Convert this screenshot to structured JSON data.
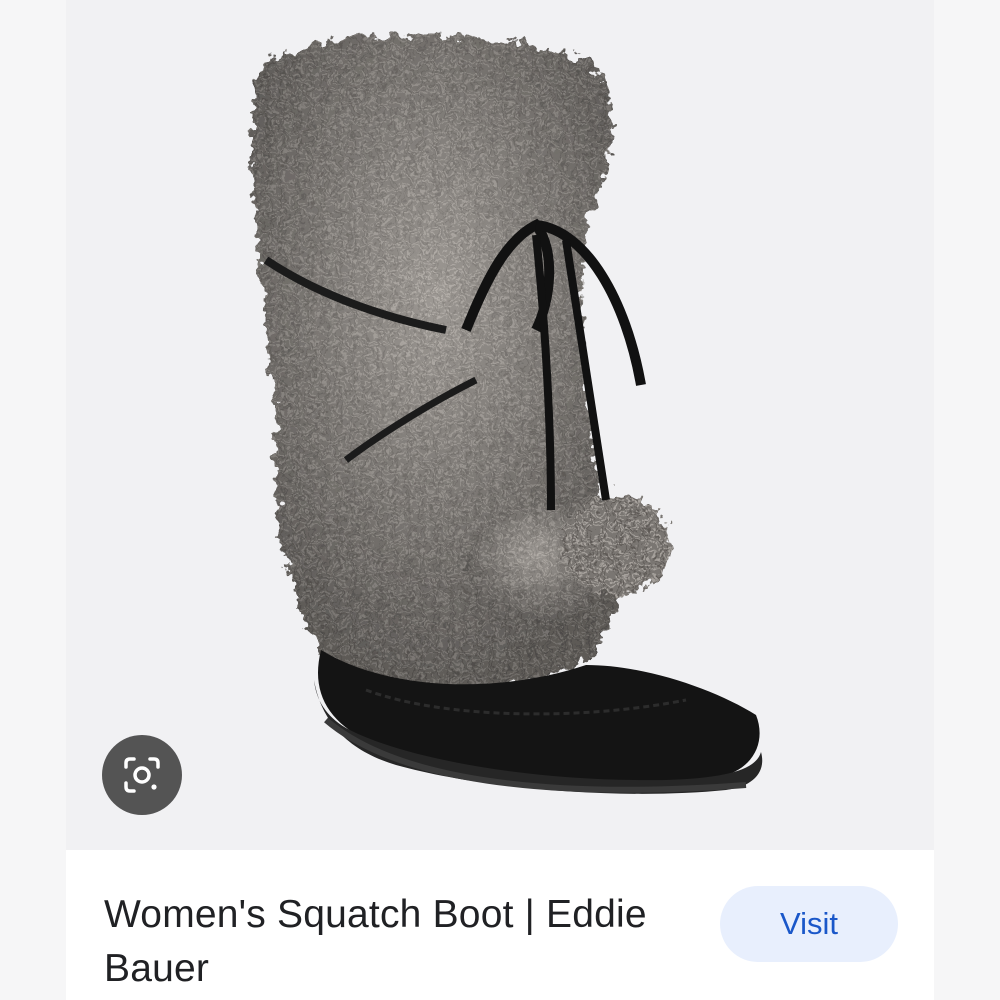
{
  "result": {
    "title": "Women's Squatch Boot | Eddie Bauer",
    "visit_label": "Visit",
    "image_alt": "Faux fur tall boot with black suede foot and black lace ties with pom-poms"
  },
  "icons": {
    "lens": "google-lens-icon"
  },
  "colors": {
    "visit_bg": "#e8effd",
    "visit_text": "#1a57c9",
    "title_text": "#202124",
    "lens_bg": "#464646"
  }
}
